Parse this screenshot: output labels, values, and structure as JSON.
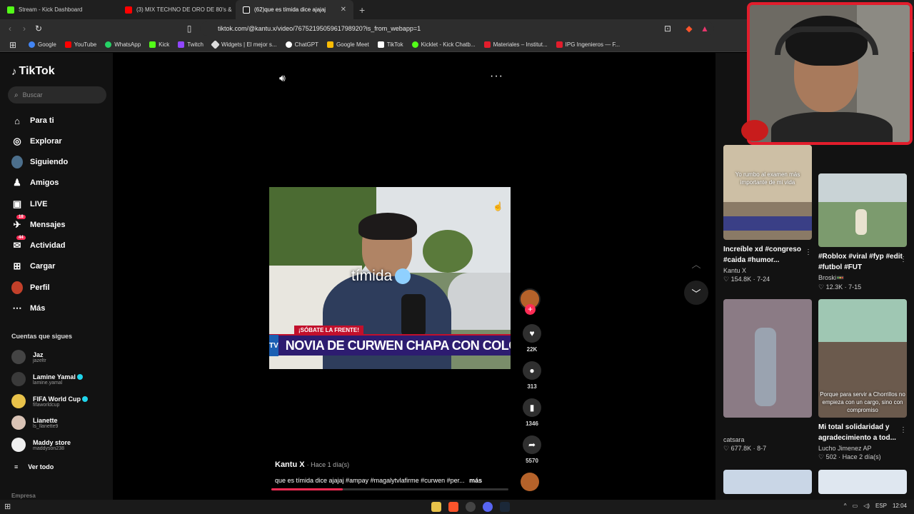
{
  "browser": {
    "tabs": [
      {
        "label": "Stream - Kick Dashboard",
        "color": "#53fc18"
      },
      {
        "label": "(3) MIX TECHNO DE ORO DE 80's &",
        "color": "#ff0000"
      },
      {
        "label": "(62)que es tímida dice ajajaj",
        "color": "#ffffff",
        "active": true
      }
    ],
    "url": "tiktok.com/@kantu.x/video/7675219505961798920?is_from_webapp=1",
    "bookmarks": [
      {
        "label": "Google",
        "color": "#4285f4"
      },
      {
        "label": "YouTube",
        "color": "#ff0000"
      },
      {
        "label": "WhatsApp",
        "color": "#25d366"
      },
      {
        "label": "Kick",
        "color": "#53fc18"
      },
      {
        "label": "Twitch",
        "color": "#9146ff"
      },
      {
        "label": "Widgets | El mejor s...",
        "color": "#dddddd"
      },
      {
        "label": "ChatGPT",
        "color": "#ffffff"
      },
      {
        "label": "Google Meet",
        "color": "#fbbc04"
      },
      {
        "label": "TikTok",
        "color": "#ffffff"
      },
      {
        "label": "Kicklet - Kick Chatb...",
        "color": "#53fc18"
      },
      {
        "label": "Materiales – Institut...",
        "color": "#e21d2c"
      },
      {
        "label": "IPG Ingenieros — F...",
        "color": "#e21d2c"
      }
    ]
  },
  "sidebar": {
    "logo": "TikTok",
    "search_placeholder": "Buscar",
    "nav": [
      {
        "label": "Para ti",
        "icon": "home-icon",
        "glyph": "⌂"
      },
      {
        "label": "Explorar",
        "icon": "compass-icon",
        "glyph": "◎"
      },
      {
        "label": "Siguiendo",
        "icon": "following-avatar-icon",
        "glyph": "●"
      },
      {
        "label": "Amigos",
        "icon": "friends-icon",
        "glyph": "♟"
      },
      {
        "label": "LIVE",
        "icon": "live-icon",
        "glyph": "▣"
      },
      {
        "label": "Mensajes",
        "icon": "messages-icon",
        "glyph": "✈",
        "badge": "18"
      },
      {
        "label": "Actividad",
        "icon": "activity-icon",
        "glyph": "✉",
        "badge": "44"
      },
      {
        "label": "Cargar",
        "icon": "upload-icon",
        "glyph": "⊞"
      },
      {
        "label": "Perfil",
        "icon": "profile-avatar-icon",
        "glyph": "●"
      },
      {
        "label": "Más",
        "icon": "more-icon",
        "glyph": "⋯"
      }
    ],
    "following_title": "Cuentas que sigues",
    "following": [
      {
        "name": "Jaz",
        "handle": "jazeltr",
        "verified": false
      },
      {
        "name": "Lamine Yamal",
        "handle": "lamine.yamal",
        "verified": true
      },
      {
        "name": "FIFA World Cup",
        "handle": "fifaworldcup",
        "verified": true
      },
      {
        "name": "Lianette",
        "handle": "ls_llanette9",
        "verified": false
      },
      {
        "name": "Maddy store",
        "handle": "maddyson238",
        "verified": false
      }
    ],
    "see_all": "Ver todo",
    "company": "Empresa"
  },
  "video": {
    "overlay_text": "tímida",
    "kicker": "¡SÓBATE LA FRENTE!",
    "chyron_tv": "TV",
    "chyron": "NOVIA DE CURWEN CHAPA CON COLORA",
    "author": "Kantu X",
    "posted": "· Hace 1 día(s)",
    "caption": "que es tímida dice ajajaj #ampay #magalytvlafirme #curwen #per...",
    "more": "más",
    "progress": 0.3,
    "likes": "22K",
    "comments": "313",
    "saves": "1346",
    "shares": "5570"
  },
  "recommended": [
    {
      "title": "Increíble xd #congreso #caida #humor...",
      "user": "Kantu X",
      "views": "154.8K",
      "date": "7-24",
      "overlay": "Yo rumbo al examen más importante de mi vida",
      "bg": "#8a7a66"
    },
    {
      "title": "#Roblox #viral #fyp #edit #futbol #FUT",
      "user": "Broski🚥",
      "views": "12.3K",
      "date": "7-15",
      "overlay": "",
      "bg": "#7c9b6e"
    },
    {
      "title": "",
      "user": "catsara",
      "views": "677.8K",
      "date": "8-7",
      "overlay": "",
      "bg": "#5a4a55"
    },
    {
      "title": "Mi total solidaridad y agradecimiento a tod...",
      "user": "Lucho Jimenez AP",
      "views": "502",
      "date": "Hace 2 día(s)",
      "overlay": "Porque para servir a Chorrillos no empieza con un cargo, sino con compromiso",
      "bg": "#6b5a4d"
    }
  ],
  "taskbar": {
    "time": "12:04"
  }
}
